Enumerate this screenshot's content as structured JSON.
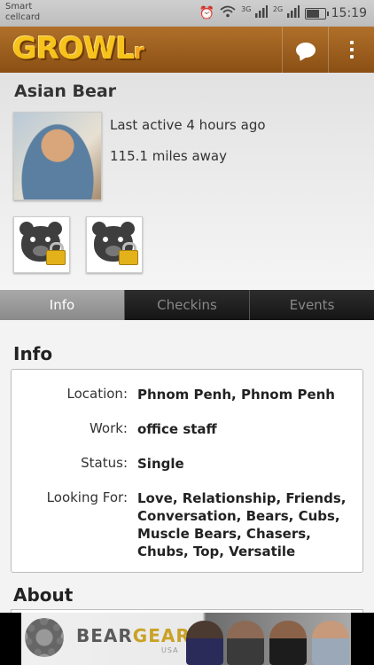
{
  "status_bar": {
    "carrier_line1": "Smart",
    "carrier_line2": "cellcard",
    "net1": "3G",
    "net2": "2G",
    "battery_level": 0.8,
    "time": "15:19"
  },
  "app_bar": {
    "logo_text": "GROWL",
    "logo_suffix": "r",
    "brand_color": "#f7c21a",
    "bar_color": "#9b5e1f",
    "chat_icon": "chat-bubble-icon",
    "menu_icon": "overflow-menu-icon"
  },
  "profile": {
    "name": "Asian Bear",
    "last_active": "Last active 4 hours ago",
    "distance": "115.1 miles away",
    "locked_photo_icon": "locked-bear-icon"
  },
  "tabs": [
    {
      "label": "Info",
      "active": true
    },
    {
      "label": "Checkins",
      "active": false
    },
    {
      "label": "Events",
      "active": false
    }
  ],
  "info": {
    "title": "Info",
    "rows": [
      {
        "label": "Location:",
        "value": "Phnom Penh, Phnom Penh"
      },
      {
        "label": "Work:",
        "value": "office staff"
      },
      {
        "label": "Status:",
        "value": "Single"
      },
      {
        "label": "Looking For:",
        "value": "Love, Relationship, Friends, Conversation, Bears, Cubs, Muscle Bears, Chasers, Chubs, Top, Versatile"
      }
    ]
  },
  "about": {
    "title": "About"
  },
  "ad": {
    "brand_part1": "BEAR",
    "brand_part2": "GEAR",
    "brand_sub": "USA"
  }
}
